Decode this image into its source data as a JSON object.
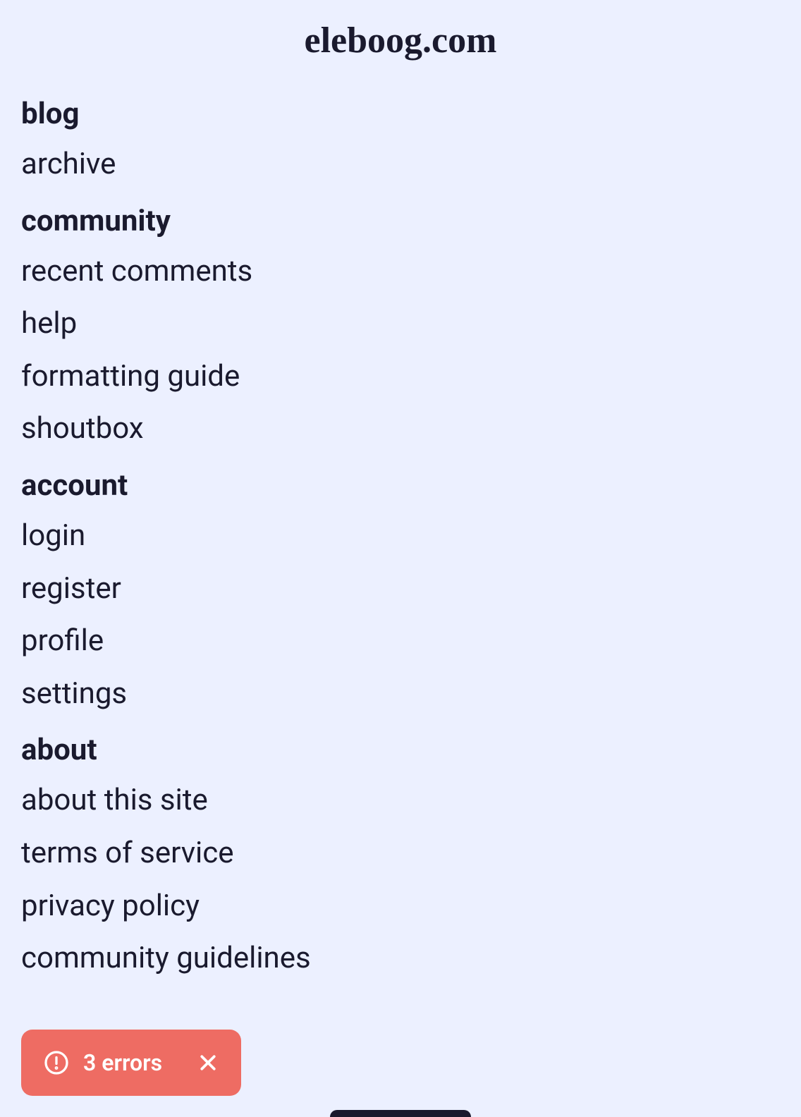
{
  "header": {
    "title": "eleboog.com"
  },
  "nav": {
    "sections": [
      {
        "heading": "blog",
        "items": [
          "archive"
        ]
      },
      {
        "heading": "community",
        "items": [
          "recent comments",
          "help",
          "formatting guide",
          "shoutbox"
        ]
      },
      {
        "heading": "account",
        "items": [
          "login",
          "register",
          "profile",
          "settings"
        ]
      },
      {
        "heading": "about",
        "items": [
          "about this site",
          "terms of service",
          "privacy policy",
          "community guidelines"
        ]
      }
    ]
  },
  "toast": {
    "message": "3 errors"
  }
}
